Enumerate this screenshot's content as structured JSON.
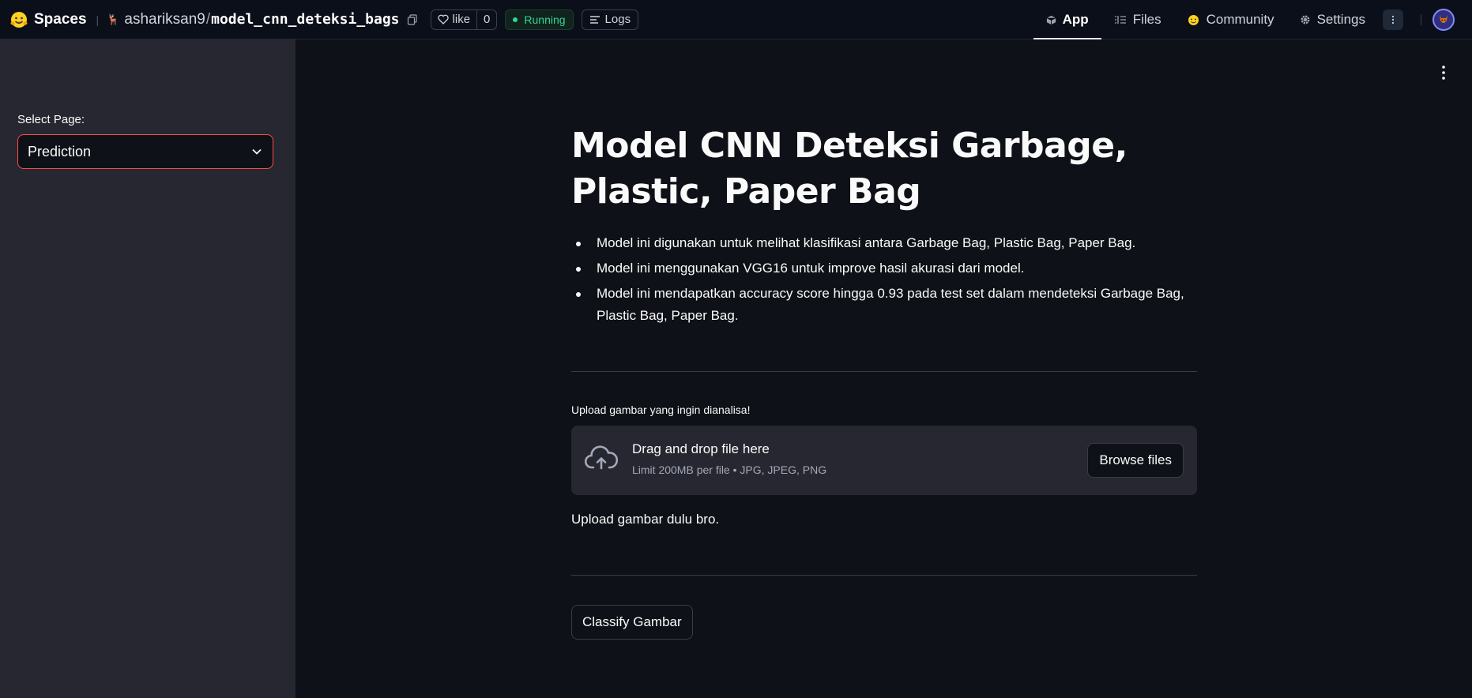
{
  "header": {
    "brand": "Spaces",
    "owner": "ashariksan9",
    "repo": "model_cnn_deteksi_bags",
    "like_label": "like",
    "like_count": "0",
    "status": "Running",
    "logs_label": "Logs",
    "tabs": [
      {
        "label": "App",
        "icon": "cube-icon",
        "active": true
      },
      {
        "label": "Files",
        "icon": "files-icon",
        "active": false
      },
      {
        "label": "Community",
        "icon": "community-icon",
        "active": false
      },
      {
        "label": "Settings",
        "icon": "gear-icon",
        "active": false
      }
    ]
  },
  "sidebar": {
    "select_label": "Select Page:",
    "select_value": "Prediction"
  },
  "main": {
    "title": "Model CNN Deteksi Garbage, Plastic, Paper Bag",
    "bullets": [
      "Model ini digunakan untuk melihat klasifikasi antara Garbage Bag, Plastic Bag, Paper Bag.",
      "Model ini menggunakan VGG16 untuk improve hasil akurasi dari model.",
      "Model ini mendapatkan accuracy score hingga 0.93 pada test set dalam mendeteksi Garbage Bag, Plastic Bag, Paper Bag."
    ],
    "upload_label": "Upload gambar yang ingin dianalisa!",
    "dropzone_title": "Drag and drop file here",
    "dropzone_sub": "Limit 200MB per file • JPG, JPEG, PNG",
    "browse_label": "Browse files",
    "status_text": "Upload gambar dulu bro.",
    "classify_label": "Classify Gambar"
  },
  "colors": {
    "accent": "#ff4b4b",
    "running": "#34d399",
    "background": "#0e1117",
    "sidebar": "#262730"
  }
}
